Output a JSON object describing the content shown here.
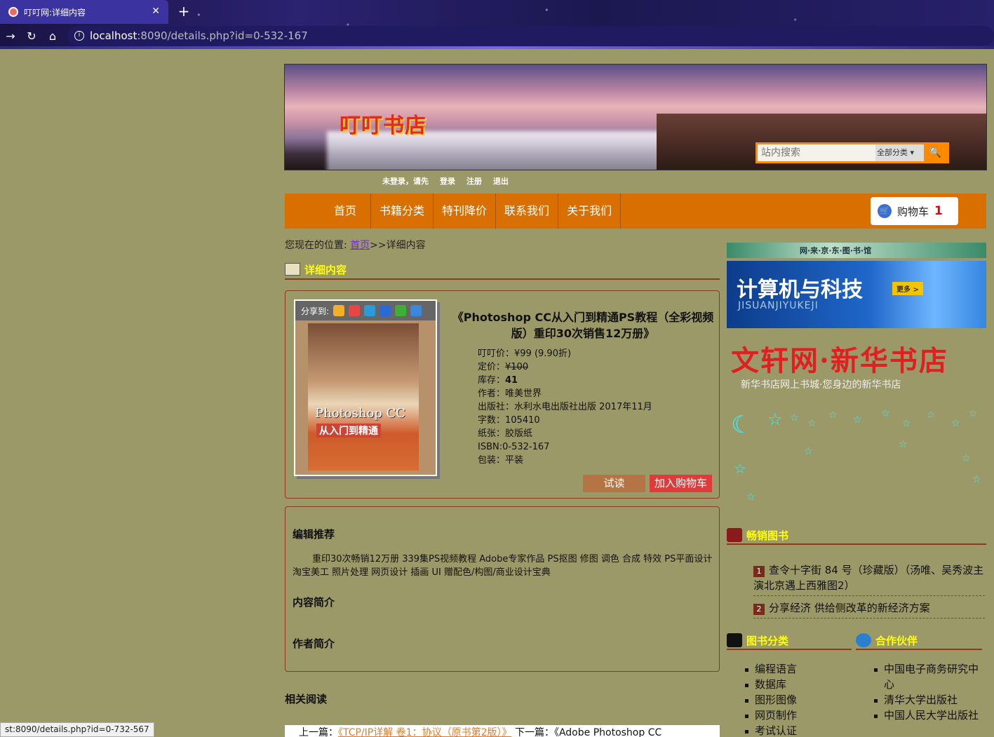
{
  "browser": {
    "tab_title": "叮叮网:详细内容",
    "url_host": "localhost",
    "url_path": ":8090/details.php?id=0-532-167",
    "status_url": "st:8090/details.php?id=0-732-567"
  },
  "header": {
    "logo": "叮叮书店",
    "search_placeholder": "站内搜索",
    "search_category": "全部分类"
  },
  "userbar": {
    "notice": "未登录，请先",
    "login": "登录",
    "register": "注册",
    "logout": "退出"
  },
  "menu": {
    "items": [
      "首页",
      "书籍分类",
      "特刊降价",
      "联系我们",
      "关于我们"
    ],
    "cart_label": "购物车",
    "cart_count": "1"
  },
  "breadcrumb": {
    "prefix": "您现在的位置:",
    "home": "首页",
    "current": ">>详细内容"
  },
  "detail": {
    "section_title": "详细内容",
    "share_label": "分享到:",
    "title": "《Photoshop CC从入门到精通PS教程（全彩视频版）重印30次销售12万册》",
    "info": {
      "price": "叮叮价：¥99 (9.90折)",
      "list_price_label": "定价：",
      "list_price": "¥100",
      "stock_label": "库存：",
      "stock": "41",
      "author": "作者：唯美世界",
      "publisher": "出版社：水利水电出版社出版 2017年11月",
      "words": "字数：105410",
      "paper": "纸张：胶版纸",
      "isbn": "ISBN:0-532-167",
      "binding": "包装：平装"
    },
    "try_button": "试读",
    "add_cart_button": "加入购物车",
    "cover_title": "Photoshop CC",
    "cover_subtitle": "从入门到精通"
  },
  "description": {
    "editor_title": "编辑推荐",
    "editor_text": "重印30次畅销12万册 339集PS视频教程 Adobe专家作品 PS抠图 修图 调色 合成 特效 PS平面设计 淘宝美工 照片处理 网页设计 插画 UI 赠配色/构图/商业设计宝典",
    "intro_title": "内容简介",
    "author_title": "作者简介"
  },
  "related": {
    "title": "相关阅读",
    "prev_label": "上一篇：",
    "prev_link": "《TCP/IP详解 卷1：协议（原书第2版）》",
    "next_label": "下一篇：",
    "next_link": "《Adobe Photoshop CC"
  },
  "sidebar": {
    "ad1_text": "网·来·京·东·图·书·馆",
    "ad2_title": "计算机与科技",
    "ad2_sub": "JISUANJIYUKEJI",
    "ad2_more": "更多 >",
    "ad3_title": "文轩网·新华书店",
    "ad3_sub": "新华书店网上书城·您身边的新华书店",
    "hot_title": "畅销图书",
    "hot": [
      {
        "n": "1",
        "text": "查令十字街 84 号（珍藏版）（汤唯、吴秀波主演北京遇上西雅图2）"
      },
      {
        "n": "2",
        "text": "分享经济 供给侧改革的新经济方案"
      }
    ],
    "cat_title": "图书分类",
    "categories": [
      "编程语言",
      "数据库",
      "图形图像",
      "网页制作",
      "考试认证"
    ],
    "partner_title": "合作伙伴",
    "partners": [
      "中国电子商务研究中心",
      "清华大学出版社",
      "中国人民大学出版社"
    ]
  },
  "colors": {
    "page_bg": "#9c9968",
    "menu_bg": "#d96f00",
    "accent_yellow": "#ffff00",
    "border_brown": "#8b3a1a"
  }
}
